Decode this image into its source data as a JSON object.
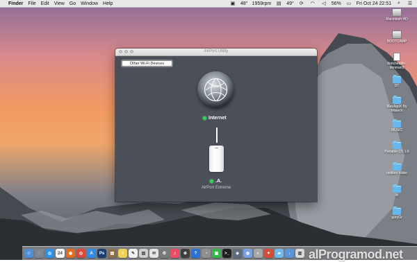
{
  "menubar": {
    "app_name": "Finder",
    "items": [
      "File",
      "Edit",
      "View",
      "Go",
      "Window",
      "Help"
    ],
    "status": {
      "cpu_temp": "48°",
      "fan": "1959rpm",
      "battery_temp": "49°",
      "battery": "56%",
      "date_time": "Fri Oct 24  22:51"
    }
  },
  "desktop_icons": [
    {
      "label": "Macintosh HD",
      "icon": "drive"
    },
    {
      "label": "BOOTCAMP",
      "icon": "drive"
    },
    {
      "label": "doncheadle-ironman3",
      "icon": "document"
    },
    {
      "label": "DT",
      "icon": "folder"
    },
    {
      "label": "MacAppX By MisterX",
      "icon": "folder"
    },
    {
      "label": "MUSIC",
      "icon": "folder"
    },
    {
      "label": "Portable CS 1.6",
      "icon": "folder"
    },
    {
      "label": "untitled folder",
      "icon": "folder"
    },
    {
      "label": "W",
      "icon": "folder"
    },
    {
      "label": "garyGr",
      "icon": "folder"
    }
  ],
  "window": {
    "title": "AirPort Utility",
    "other_devices_button": "Other Wi-Fi Devices",
    "internet_label": "Internet",
    "device_name": ".A.",
    "device_model": "AirPort Extreme"
  },
  "dock_icons": [
    {
      "name": "finder-icon",
      "label": "☺",
      "color": "#4f8fd8"
    },
    {
      "name": "launchpad-icon",
      "label": "◌",
      "color": "#7d8794"
    },
    {
      "name": "safari-icon",
      "label": "◎",
      "color": "#2e91e8"
    },
    {
      "name": "calendar-icon",
      "label": "24",
      "color": "#f7f7f7"
    },
    {
      "name": "firefox-icon",
      "label": "◉",
      "color": "#e56b1f"
    },
    {
      "name": "chrome-icon",
      "label": "◎",
      "color": "#d84a3a"
    },
    {
      "name": "app-store-icon",
      "label": "A",
      "color": "#2f8be8"
    },
    {
      "name": "photoshop-icon",
      "label": "Ps",
      "color": "#1c3c70"
    },
    {
      "name": "document-icon",
      "label": "▤",
      "color": "#8a6f48"
    },
    {
      "name": "notes-icon",
      "label": "≡",
      "color": "#f2d15a"
    },
    {
      "name": "pages-icon",
      "label": "✎",
      "color": "#f1f1f1"
    },
    {
      "name": "preview-icon",
      "label": "▧",
      "color": "#cfcfcf"
    },
    {
      "name": "mail-icon",
      "label": "✉",
      "color": "#e5e5e5"
    },
    {
      "name": "system-preferences-icon",
      "label": "⚙",
      "color": "#7a7a7a"
    },
    {
      "name": "music-icon",
      "label": "♫",
      "color": "#f04a65"
    },
    {
      "name": "garage-icon",
      "label": "⊕",
      "color": "#3d3d3d"
    },
    {
      "name": "help-icon",
      "label": "?",
      "color": "#2c73d8"
    },
    {
      "name": "messages-icon",
      "label": "◔",
      "color": "#8f8f8f"
    },
    {
      "name": "facetime-icon",
      "label": "▣",
      "color": "#35b84a"
    },
    {
      "name": "terminal-icon",
      "label": ">_",
      "color": "#202020"
    },
    {
      "name": "app-icon",
      "label": "◈",
      "color": "#5d6b7a"
    },
    {
      "name": "network-icon",
      "label": "◍",
      "color": "#79a1e5"
    },
    {
      "name": "utility-icon",
      "label": "◐",
      "color": "#a8a8a8"
    },
    {
      "name": "pdf-icon",
      "label": "✦",
      "color": "#d84b35"
    },
    {
      "name": "folder-icon",
      "label": "▰",
      "color": "#6fb9ef"
    },
    {
      "name": "download-icon",
      "label": "↓",
      "color": "#5a95d9"
    },
    {
      "name": "trash-icon",
      "label": "▥",
      "color": "#dadada"
    }
  ],
  "watermark": "alProgramod.net"
}
